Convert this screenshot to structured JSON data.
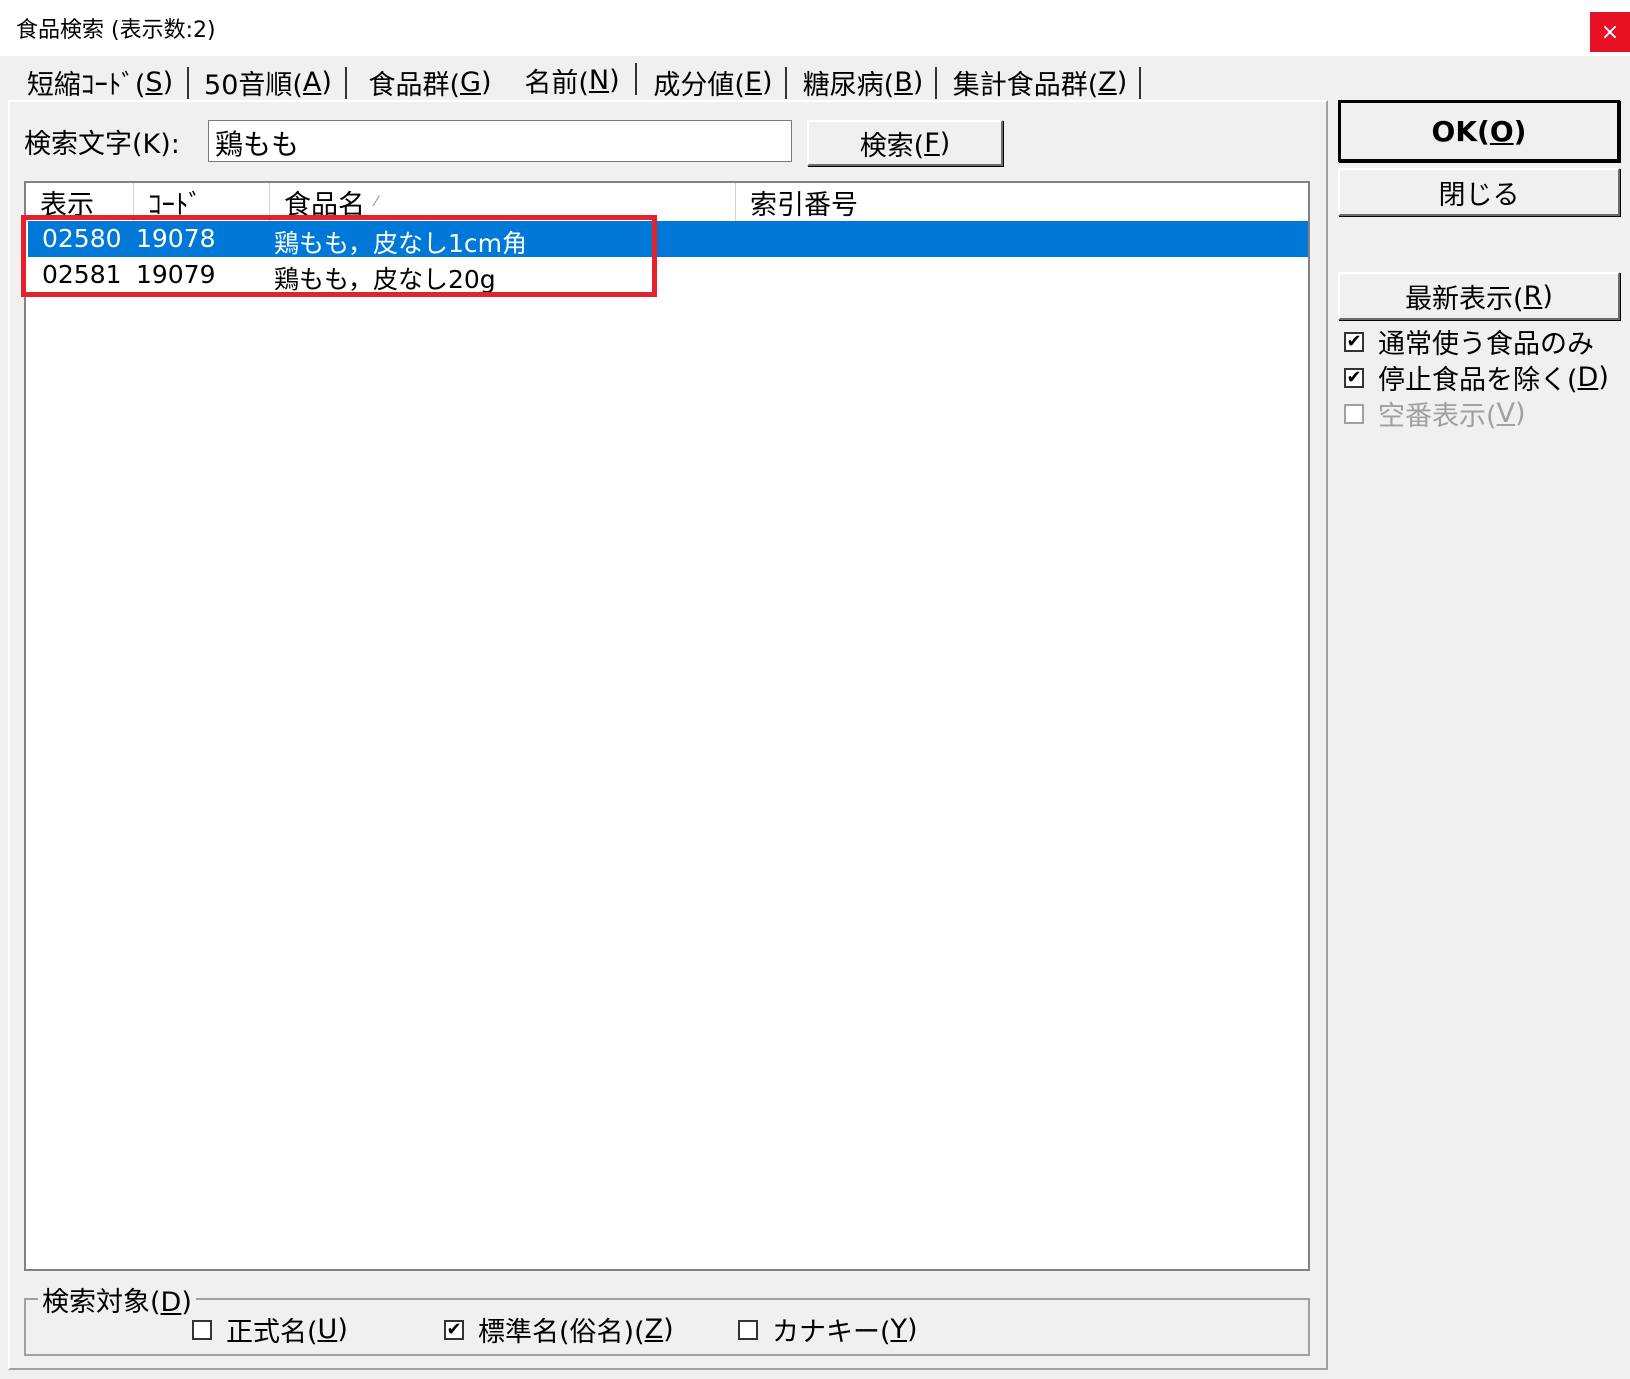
{
  "window": {
    "title": "食品検索 (表示数:2)",
    "close_glyph": "×"
  },
  "tabs": [
    {
      "label": "短縮ｺｰﾄﾞ(",
      "mn": "S",
      "tail": ")"
    },
    {
      "label": "50音順(",
      "mn": "A",
      "tail": ")"
    },
    {
      "label": "食品群(",
      "mn": "G",
      "tail": ")"
    },
    {
      "label": "名前(",
      "mn": "N",
      "tail": ")"
    },
    {
      "label": "成分値(",
      "mn": "E",
      "tail": ")"
    },
    {
      "label": "糖尿病(",
      "mn": "B",
      "tail": ")"
    },
    {
      "label": "集計食品群(",
      "mn": "Z",
      "tail": ")"
    }
  ],
  "search": {
    "label": "検索文字(K):",
    "value": "鶏もも",
    "button_pre": "検索(",
    "button_mn": "F",
    "button_post": ")"
  },
  "list": {
    "columns": [
      "表示",
      "ｺｰﾄﾞ",
      "食品名",
      "索引番号"
    ],
    "sort_glyph": "⁄",
    "rows": [
      {
        "display": "02580",
        "code": "19078",
        "name": "鶏もも，皮なし1cm角",
        "index": ""
      },
      {
        "display": "02581",
        "code": "19079",
        "name": "鶏もも，皮なし20g",
        "index": ""
      }
    ]
  },
  "side": {
    "ok_pre": "OK(",
    "ok_mn": "O",
    "ok_post": ")",
    "close": "閉じる",
    "refresh_pre": "最新表示(",
    "refresh_mn": "R",
    "refresh_post": ")",
    "opt1": "通常使う食品のみ",
    "opt2_pre": "停止食品を除く(",
    "opt2_mn": "D",
    "opt2_post": ")",
    "opt3_pre": "空番表示(",
    "opt3_mn": "V",
    "opt3_post": ")"
  },
  "target": {
    "label_pre": "検索対象(",
    "label_mn": "D",
    "label_post": ")",
    "o1_pre": "正式名(",
    "o1_mn": "U",
    "o1_post": ")",
    "o2_pre": "標準名(俗名)(",
    "o2_mn": "Z",
    "o2_post": ")",
    "o3_pre": "カナキー(",
    "o3_mn": "Y",
    "o3_post": ")"
  },
  "check_glyph": "✔"
}
